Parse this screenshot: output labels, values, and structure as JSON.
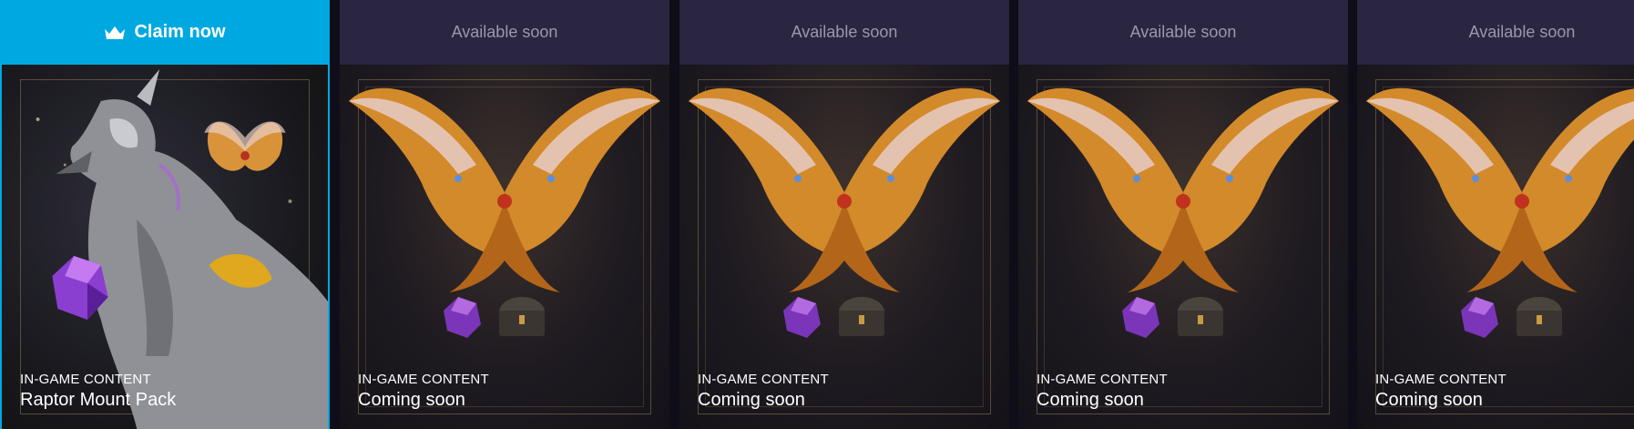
{
  "cards": [
    {
      "header": "Claim now",
      "header_icon": "crown-icon",
      "kicker": "IN-GAME CONTENT",
      "title": "Raptor Mount Pack",
      "state": "active"
    },
    {
      "header": "Available soon",
      "kicker": "IN-GAME CONTENT",
      "title": "Coming soon",
      "state": "locked"
    },
    {
      "header": "Available soon",
      "kicker": "IN-GAME CONTENT",
      "title": "Coming soon",
      "state": "locked"
    },
    {
      "header": "Available soon",
      "kicker": "IN-GAME CONTENT",
      "title": "Coming soon",
      "state": "locked"
    },
    {
      "header": "Available soon",
      "kicker": "IN-GAME CONTENT",
      "title": "Coming soon",
      "state": "locked"
    }
  ],
  "colors": {
    "accent": "#00a8e1",
    "locked_header": "#2a2540",
    "locked_header_text": "#9b97ad"
  }
}
